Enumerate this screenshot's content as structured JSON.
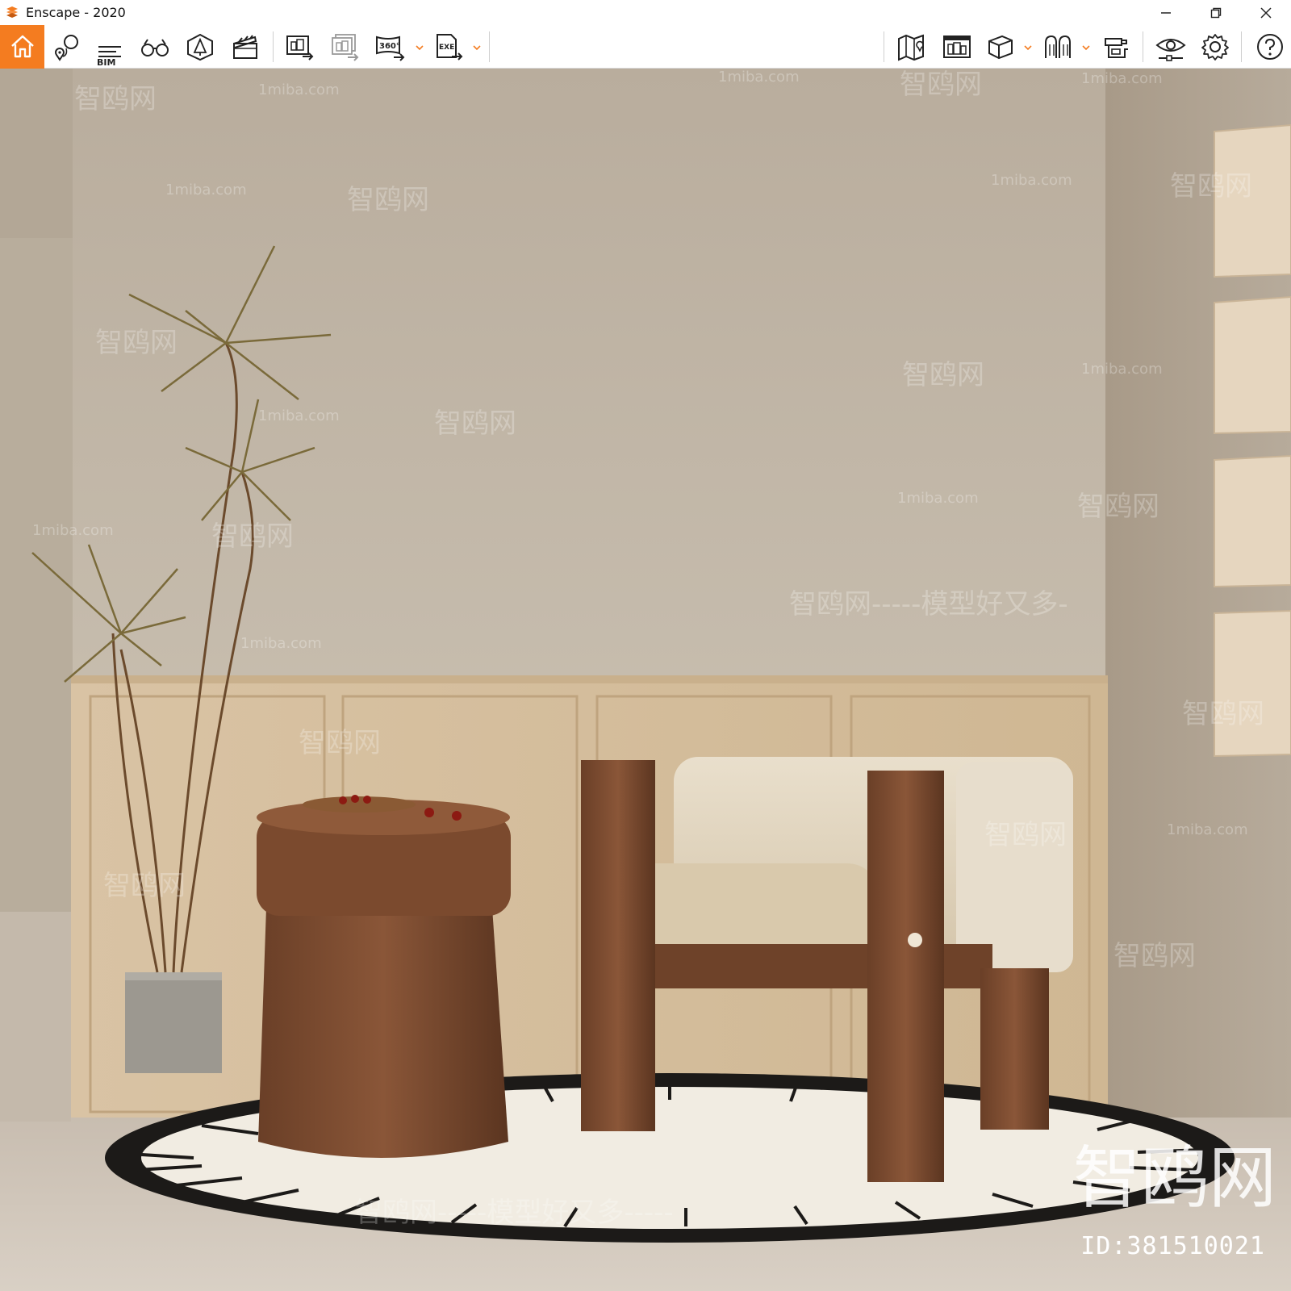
{
  "window": {
    "title": "Enscape - 2020",
    "accent_color": "#f47c20"
  },
  "toolbar": {
    "left_buttons": [
      {
        "name": "home",
        "icon": "home-icon",
        "active": true
      },
      {
        "name": "views",
        "icon": "location-views-icon"
      },
      {
        "name": "bim",
        "icon": "bim-icon",
        "label": "BIM"
      },
      {
        "name": "binoculars",
        "icon": "binoculars-icon"
      },
      {
        "name": "assets",
        "icon": "asset-library-icon"
      },
      {
        "name": "video-editor",
        "icon": "clapperboard-icon"
      },
      {
        "name": "screenshot",
        "icon": "render-export-icon"
      },
      {
        "name": "batch-render",
        "icon": "batch-render-icon"
      },
      {
        "name": "panorama-360",
        "icon": "panorama-360-icon"
      },
      {
        "name": "export-exe",
        "icon": "export-exe-icon"
      }
    ],
    "right_buttons": [
      {
        "name": "map",
        "icon": "map-icon"
      },
      {
        "name": "web-standalone",
        "icon": "web-export-icon"
      },
      {
        "name": "views-box",
        "icon": "cube-icon"
      },
      {
        "name": "vr-headset",
        "icon": "vr-headset-icon"
      },
      {
        "name": "live-updates",
        "icon": "sync-icon"
      },
      {
        "name": "visual-settings",
        "icon": "eye-settings-icon"
      },
      {
        "name": "settings",
        "icon": "gear-icon"
      },
      {
        "name": "help",
        "icon": "help-icon"
      }
    ]
  },
  "viewport": {
    "watermarks": {
      "site": "1miba.com",
      "brand_cn": "智鸥网",
      "slogan": "智鸥网-----模型好又多-",
      "slogan_bottom": "智鸥网-----模型好又多-----"
    },
    "image_id": "ID:381510021"
  }
}
